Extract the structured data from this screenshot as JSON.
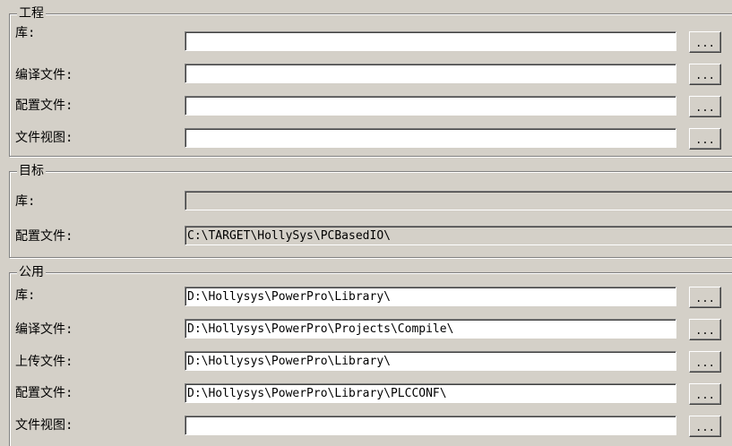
{
  "browse_label": "...",
  "project": {
    "title": "工程",
    "rows": [
      {
        "label": "库:",
        "value": ""
      },
      {
        "label": "编译文件:",
        "value": ""
      },
      {
        "label": "配置文件:",
        "value": ""
      },
      {
        "label": "文件视图:",
        "value": ""
      }
    ]
  },
  "target": {
    "title": "目标",
    "rows": [
      {
        "label": "库:",
        "value": ""
      },
      {
        "label": "配置文件:",
        "value": "C:\\TARGET\\HollySys\\PCBasedIO\\"
      }
    ]
  },
  "common": {
    "title": "公用",
    "rows": [
      {
        "label": "库:",
        "value": "D:\\Hollysys\\PowerPro\\Library\\"
      },
      {
        "label": "编译文件:",
        "value": "D:\\Hollysys\\PowerPro\\Projects\\Compile\\"
      },
      {
        "label": "上传文件:",
        "value": "D:\\Hollysys\\PowerPro\\Library\\"
      },
      {
        "label": "配置文件:",
        "value": "D:\\Hollysys\\PowerPro\\Library\\PLCCONF\\"
      },
      {
        "label": "文件视图:",
        "value": ""
      }
    ]
  }
}
